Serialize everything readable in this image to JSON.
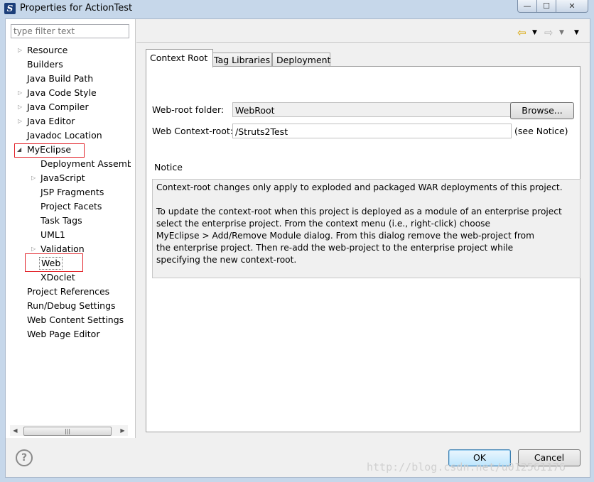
{
  "window": {
    "title": "Properties for ActionTest",
    "minimize": "—",
    "maximize": "☐",
    "close": "✕"
  },
  "filter": {
    "placeholder": "type filter text"
  },
  "tree": {
    "resource": "Resource",
    "builders": "Builders",
    "java_build_path": "Java Build Path",
    "java_code_style": "Java Code Style",
    "java_compiler": "Java Compiler",
    "java_editor": "Java Editor",
    "javadoc_location": "Javadoc Location",
    "myeclipse": "MyEclipse",
    "deployment_assembly": "Deployment Assembly",
    "javascript": "JavaScript",
    "jsp_fragments": "JSP Fragments",
    "project_facets": "Project Facets",
    "task_tags": "Task Tags",
    "uml1": "UML1",
    "validation": "Validation",
    "web": "Web",
    "xdoclet": "XDoclet",
    "project_references": "Project References",
    "run_debug_settings": "Run/Debug Settings",
    "web_content_settings": "Web Content Settings",
    "web_page_editor": "Web Page Editor"
  },
  "tabs": {
    "context_root": "Context Root",
    "tag_libraries": "Tag Libraries",
    "deployment": "Deployment"
  },
  "form": {
    "web_root_label": "Web-root folder:",
    "web_root_value": "WebRoot",
    "browse": "Browse...",
    "context_root_label": "Web Context-root:",
    "context_root_value": "/Struts2Test",
    "see_notice": "(see Notice)"
  },
  "notice": {
    "title": "Notice",
    "line1": "Context-root changes only apply to exploded and packaged WAR deployments of this project.",
    "line2": "To update the context-root when this project is deployed as a module of an enterprise project",
    "line3": "select the enterprise project. From the context menu (i.e., right-click) choose",
    "line4": "MyEclipse > Add/Remove Module dialog. From this dialog remove the web-project from",
    "line5": "the enterprise project. Then re-add the web-project to the enterprise project while",
    "line6": "specifying the new context-root."
  },
  "buttons": {
    "help": "?",
    "ok": "OK",
    "cancel": "Cancel"
  },
  "watermark": "http://blog.csdn.net/u012561176"
}
